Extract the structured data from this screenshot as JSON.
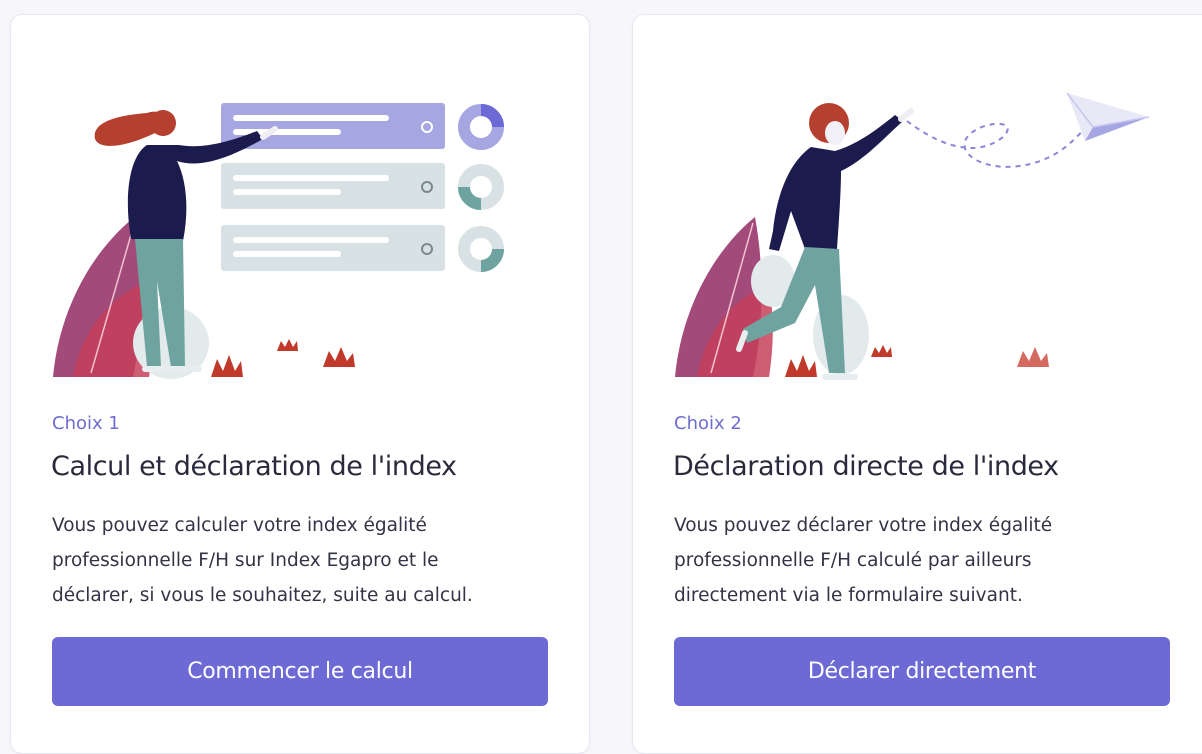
{
  "cards": [
    {
      "choice": "Choix 1",
      "title": "Calcul et déclaration de l'index",
      "description_lines": [
        "Vous pouvez calculer votre index égalité",
        "professionnelle F/H sur Index Egapro et le",
        "déclarer, si vous le souhaitez, suite au calcul."
      ],
      "button": "Commencer le calcul",
      "illustration": "woman-pointing-at-charts"
    },
    {
      "choice": "Choix 2",
      "title": "Déclaration directe de l'index",
      "description_lines": [
        "Vous pouvez déclarer votre index égalité",
        "professionnelle F/H calculé par ailleurs",
        "directement via le formulaire suivant."
      ],
      "button": "Déclarer directement",
      "illustration": "person-throwing-paper-plane"
    }
  ],
  "colors": {
    "accent": "#6d69d5",
    "choice_label": "#6e6cd0",
    "title": "#2a2a3d",
    "body_text": "#333346",
    "navy": "#1c1b4d",
    "hair_red": "#b5402f",
    "pants_teal": "#6ea3a0",
    "panel_lavender": "#a6a6e3",
    "panel_grey": "#d8e2e4"
  }
}
